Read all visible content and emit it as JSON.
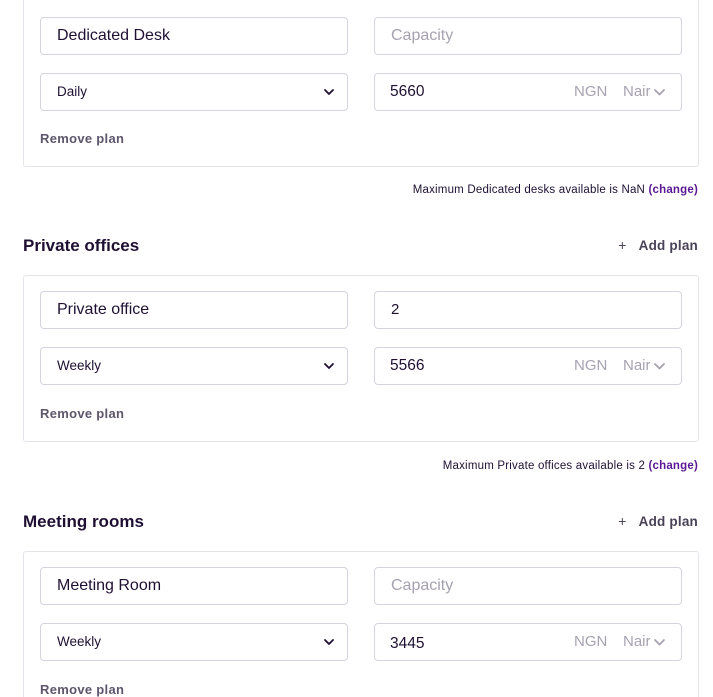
{
  "dedicated_desks": {
    "plan": {
      "name_value": "Dedicated Desk",
      "capacity_value": "",
      "capacity_placeholder": "Capacity",
      "frequency": "Daily",
      "price": "5660",
      "currency_code": "NGN",
      "currency_name": "Naira",
      "remove_label": "Remove plan"
    },
    "max_note_text": "Maximum Dedicated desks available is NaN",
    "change_label": "(change)"
  },
  "private_offices": {
    "title": "Private offices",
    "add_plan_label": "Add plan",
    "plan": {
      "name_value": "Private office",
      "capacity_value": "2",
      "capacity_placeholder": "Capacity",
      "frequency": "Weekly",
      "price": "5566",
      "currency_code": "NGN",
      "currency_name": "Naira",
      "remove_label": "Remove plan"
    },
    "max_note_text": "Maximum Private offices available is 2",
    "change_label": "(change)"
  },
  "meeting_rooms": {
    "title": "Meeting rooms",
    "add_plan_label": "Add plan",
    "plan": {
      "name_value": "Meeting Room",
      "capacity_value": "",
      "capacity_placeholder": "Capacity",
      "frequency": "Weekly",
      "price": "3445",
      "currency_code": "NGN",
      "currency_name": "Naira",
      "remove_label": "Remove plan"
    }
  },
  "icons": {
    "select_chevron": "chevron-down-icon",
    "currency_chevron": "chevron-down-icon",
    "add": "plus-icon"
  },
  "colors": {
    "accent": "#5b1896",
    "text": "#1f1033",
    "muted": "#a7a2b0",
    "border": "#d6d3dc"
  }
}
